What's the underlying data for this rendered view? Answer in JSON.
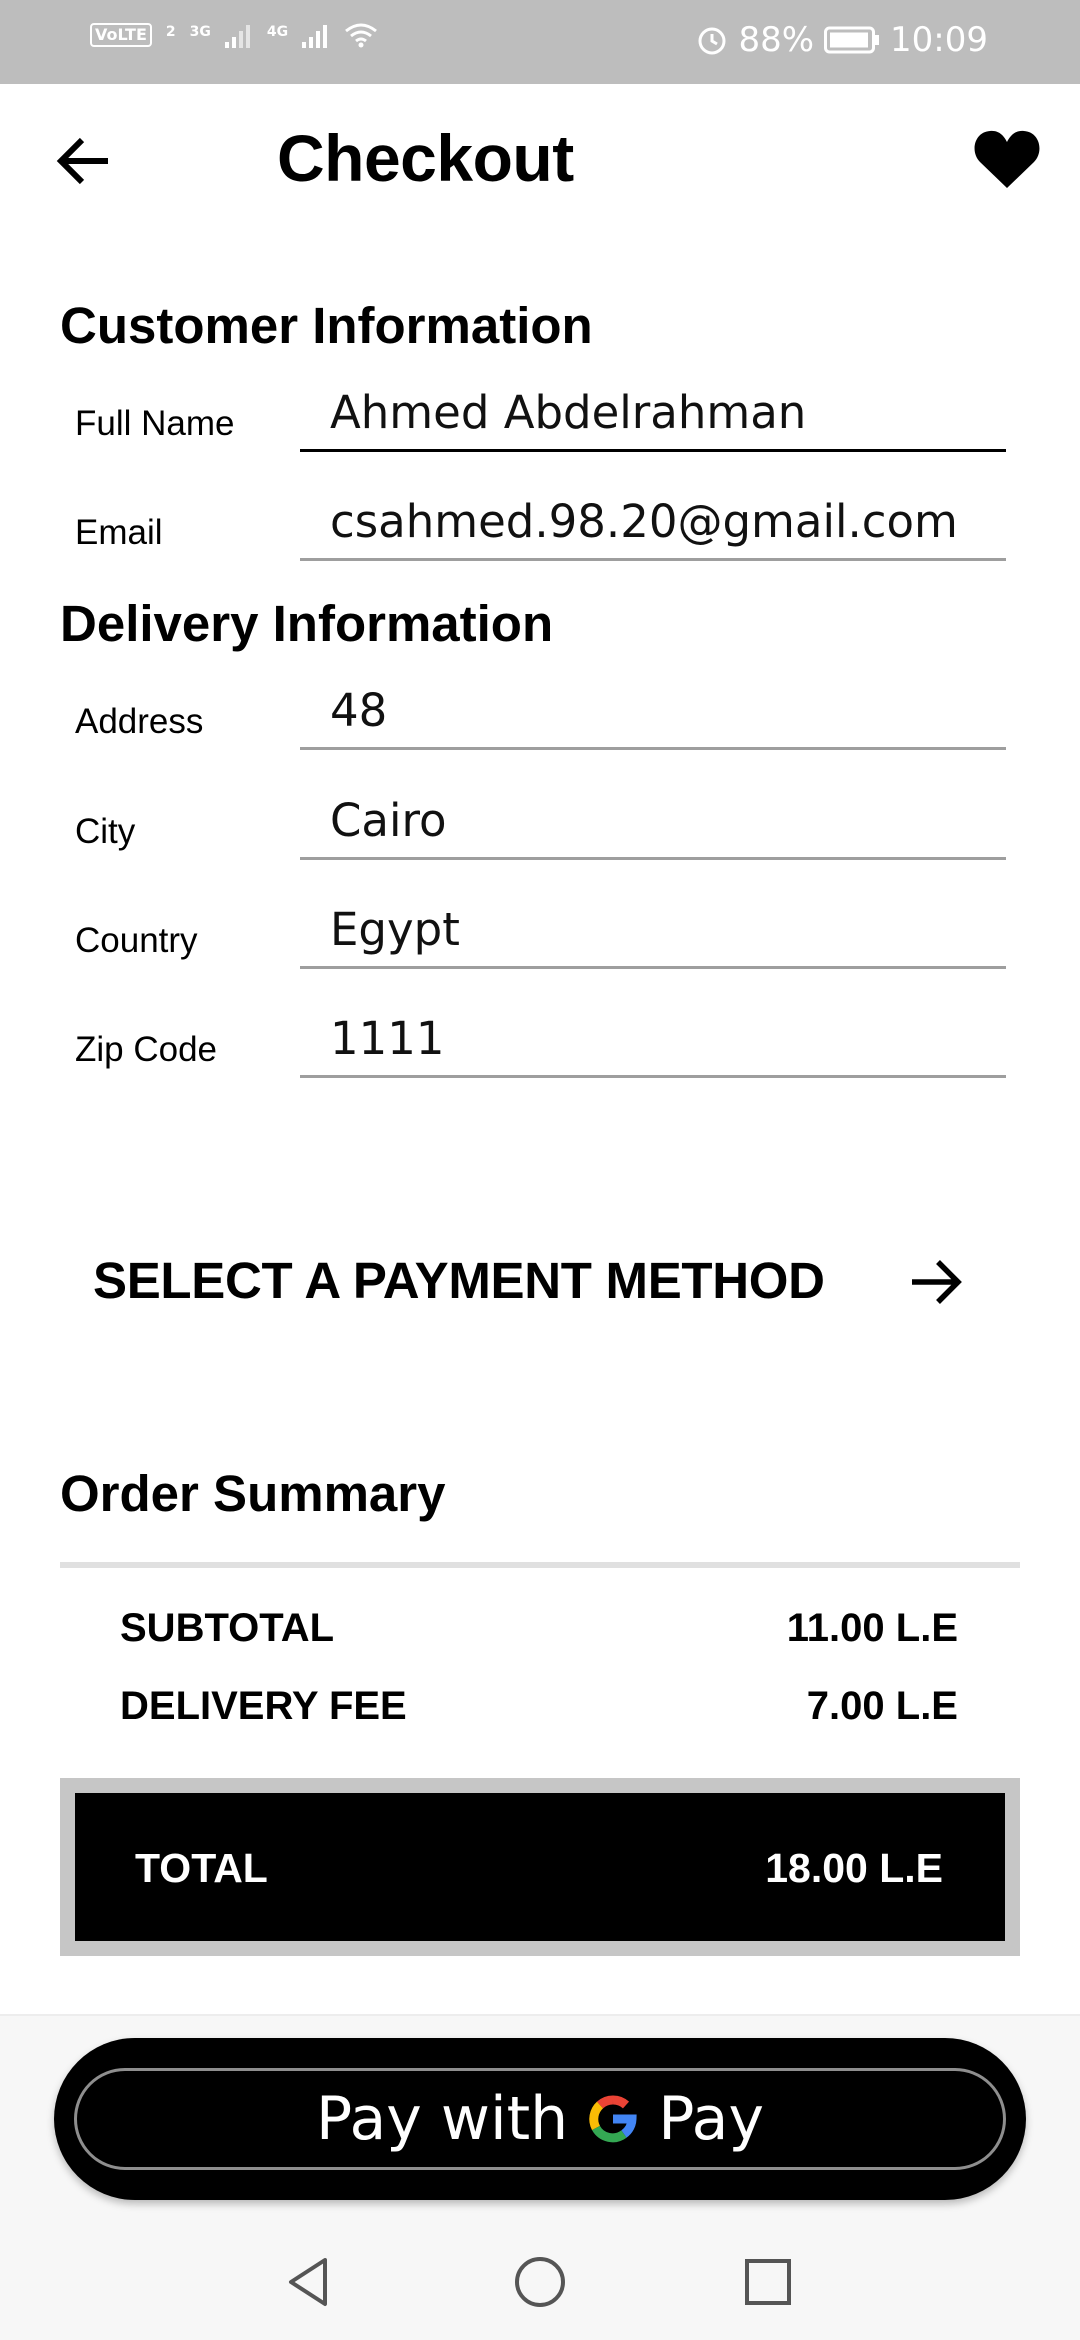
{
  "status_bar": {
    "volte": "VoLTE",
    "sim_label": "2",
    "network_1": "3G",
    "network_2": "4G",
    "battery": "88%",
    "time": "10:09",
    "icons": [
      "volte-icon",
      "signal-icon",
      "signal-icon",
      "wifi-icon",
      "alarm-icon",
      "battery-icon"
    ]
  },
  "header": {
    "title": "Checkout",
    "back_icon": "arrow-left-icon",
    "favorite_icon": "heart-icon"
  },
  "customer": {
    "heading": "Customer Information",
    "fields": [
      {
        "label": "Full Name",
        "value": "Ahmed Abdelrahman"
      },
      {
        "label": "Email",
        "value": "csahmed.98.20@gmail.com"
      }
    ]
  },
  "delivery": {
    "heading": "Delivery Information",
    "fields": [
      {
        "label": "Address",
        "value": "48"
      },
      {
        "label": "City",
        "value": "Cairo"
      },
      {
        "label": "Country",
        "value": "Egypt"
      },
      {
        "label": "Zip Code",
        "value": "1111"
      }
    ]
  },
  "payment": {
    "label": "SELECT A PAYMENT METHOD",
    "icon": "arrow-right-icon"
  },
  "summary": {
    "heading": "Order Summary",
    "subtotal_label": "SUBTOTAL",
    "subtotal_value": "11.00 L.E",
    "delivery_label": "DELIVERY FEE",
    "delivery_value": "7.00 L.E",
    "total_label": "TOTAL",
    "total_value": "18.00 L.E"
  },
  "gpay": {
    "prefix": "Pay with",
    "suffix": "Pay",
    "icon": "google-g-icon"
  },
  "nav": {
    "icons": [
      "back-triangle-icon",
      "home-circle-icon",
      "recents-square-icon"
    ]
  },
  "colors": {
    "status_bar": "#bdbdbd",
    "accent": "#000000",
    "total_frame": "#c6c6c6",
    "underline": "#9e9e9e"
  }
}
